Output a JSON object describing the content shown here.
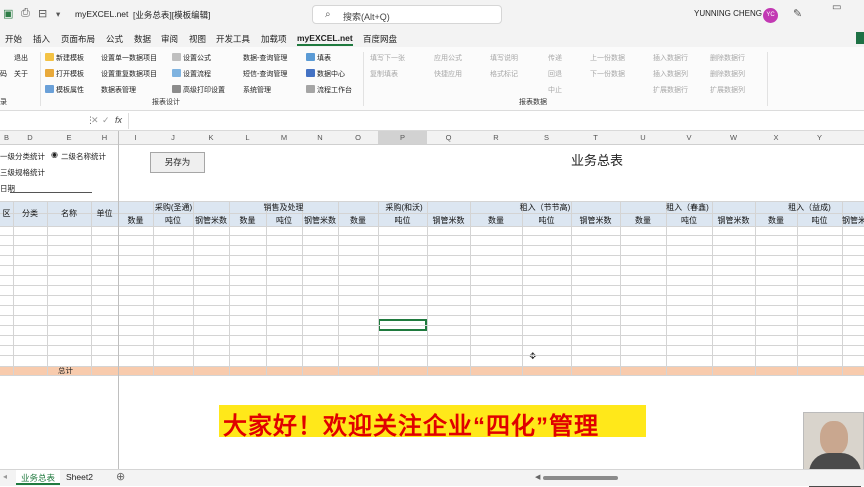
{
  "titlebar": {
    "filename": "myEXCEL.net",
    "doc_title": "[业务总表][模板编辑]",
    "user": "YUNNING CHENG",
    "avatar_initials": "YC"
  },
  "search": {
    "placeholder": "搜索(Alt+Q)"
  },
  "tabs": [
    "开始",
    "插入",
    "页面布局",
    "公式",
    "数据",
    "审阅",
    "视图",
    "开发工具",
    "加载项",
    "myEXCEL.net",
    "百度网盘"
  ],
  "ribbon": {
    "col0": [
      "退出",
      "关于"
    ],
    "col0b": [
      "码"
    ],
    "template": [
      "新建模板",
      "打开模板",
      "模板属性"
    ],
    "setup": [
      "设置单一数据项目",
      "设置重复数据项目",
      "数据表管理"
    ],
    "formula": [
      "设置公式",
      "设置流程",
      "高级打印设置"
    ],
    "query": [
      "数据-查询管理",
      "短信-查询管理",
      "系统管理"
    ],
    "center": [
      "填表",
      "数据中心",
      "流程工作台"
    ],
    "entry": [
      "填写下一张",
      "复制填表"
    ],
    "apply": [
      "应用公式",
      "快捷应用"
    ],
    "explain": [
      "填写说明",
      "格式标记"
    ],
    "flow": [
      "传递",
      "回退",
      "中止"
    ],
    "nav": [
      "上一份数据",
      "下一份数据"
    ],
    "rows": [
      "插入数据行",
      "插入数据列",
      "扩展数据行"
    ],
    "delrows": [
      "删除数据行",
      "删除数据列",
      "扩展数据列"
    ],
    "groups": [
      "录",
      "报表设计",
      "报表数据"
    ]
  },
  "columns": [
    "B",
    "D",
    "E",
    "H",
    "I",
    "J",
    "K",
    "L",
    "M",
    "N",
    "O",
    "P",
    "Q",
    "R",
    "S",
    "T",
    "U",
    "V",
    "W",
    "X",
    "Y"
  ],
  "fx": "fx",
  "sheet": {
    "opt1": "一级分类统计",
    "opt2": "二级名称统计",
    "opt3": "三级规格统计",
    "date_label": "日期",
    "saveas_button": "另存为",
    "report_title": "业务总表",
    "fixed_headers": [
      "区",
      "分类",
      "名称",
      "单位"
    ],
    "groups": [
      "采购(圣通)",
      "销售及处理",
      "采购(和沃)",
      "租入（节节高)",
      "租入（春鑫)",
      "租入（益成)"
    ],
    "sub_headers": [
      "数量",
      "吨位",
      "钢管米数"
    ],
    "total_label": "总计"
  },
  "banner": "大家好！欢迎关注企业“四化”管理",
  "sheet_tabs": [
    "业务总表",
    "Sheet2"
  ]
}
